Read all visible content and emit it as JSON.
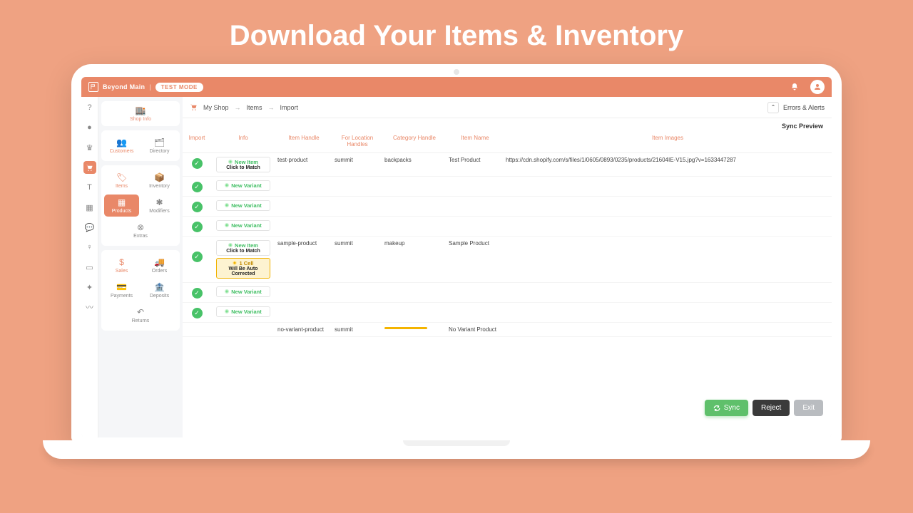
{
  "hero": {
    "title": "Download Your Items & Inventory"
  },
  "topbar": {
    "brand": "Beyond Main",
    "mode": "TEST MODE"
  },
  "subnav": {
    "shop_info": "Shop Info",
    "customers": "Customers",
    "directory": "Directory",
    "items": "Items",
    "inventory": "Inventory",
    "products": "Products",
    "modifiers": "Modifiers",
    "extras": "Extras",
    "sales": "Sales",
    "orders": "Orders",
    "payments": "Payments",
    "deposits": "Deposits",
    "returns": "Returns"
  },
  "crumb": {
    "root": "My Shop",
    "a": "Items",
    "b": "Import",
    "errors": "Errors & Alerts"
  },
  "sync_preview": "Sync Preview",
  "thead": {
    "import": "Import",
    "info": "Info",
    "item_handle": "Item Handle",
    "for_location": "For Location Handles",
    "category": "Category Handle",
    "item_name": "Item Name",
    "images": "Item Images"
  },
  "tags": {
    "new_item": "New Item",
    "click_match": "Click to Match",
    "new_variant": "New Variant",
    "one_cell": "1 Cell",
    "auto_correct": "Will Be Auto Corrected"
  },
  "rows": [
    {
      "handle": "test-product",
      "loc": "summit",
      "cat": "backpacks",
      "name": "Test Product",
      "img": "https://cdn.shopify.com/s/files/1/0605/0893/0235/products/21604IE-V15.jpg?v=1633447287"
    },
    {
      "handle": "sample-product",
      "loc": "summit",
      "cat": "makeup",
      "name": "Sample Product",
      "img": ""
    },
    {
      "handle": "no-variant-product",
      "loc": "summit",
      "cat": "",
      "name": "No Variant Product",
      "img": ""
    }
  ],
  "buttons": {
    "sync": "Sync",
    "reject": "Reject",
    "exit": "Exit"
  }
}
